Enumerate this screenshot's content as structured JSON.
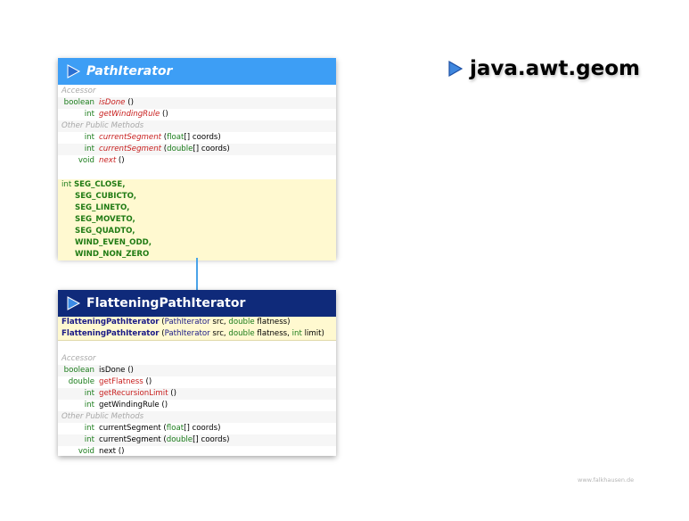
{
  "package": {
    "name": "java.awt.geom"
  },
  "footer": "www.falkhausen.de",
  "path_iterator": {
    "title": "PathIterator",
    "cat_accessor": "Accessor",
    "cat_other": "Other Public Methods",
    "m1_ret": "boolean",
    "m1_name": "isDone",
    "m1_args": " ()",
    "m2_ret": "int",
    "m2_name": "getWindingRule",
    "m2_args": " ()",
    "m3_ret": "int",
    "m3_name": "currentSegment",
    "m3_p1": " (",
    "m3_type": "float",
    "m3_rest": "[] coords)",
    "m4_ret": "int",
    "m4_name": "currentSegment",
    "m4_p1": " (",
    "m4_type": "double",
    "m4_rest": "[] coords)",
    "m5_ret": "void",
    "m5_name": "next",
    "m5_args": " ()",
    "const_type": "int",
    "constants": [
      "SEG_CLOSE,",
      "SEG_CUBICTO,",
      "SEG_LINETO,",
      "SEG_MOVETO,",
      "SEG_QUADTO,",
      "WIND_EVEN_ODD,",
      "WIND_NON_ZERO"
    ]
  },
  "flattening": {
    "title": "FlatteningPathIterator",
    "c1_name": "FlatteningPathIterator",
    "c1_p1": " (",
    "c1_t1": "PathIterator",
    "c1_a1": " src, ",
    "c1_t2": "double",
    "c1_a2": " flatness)",
    "c2_name": "FlatteningPathIterator",
    "c2_p1": " (",
    "c2_t1": "PathIterator",
    "c2_a1": " src, ",
    "c2_t2": "double",
    "c2_a2": " flatness, ",
    "c2_t3": "int",
    "c2_a3": " limit)",
    "cat_accessor": "Accessor",
    "cat_other": "Other Public Methods",
    "a1_ret": "boolean",
    "a1_name": "isDone ()",
    "a2_ret": "double",
    "a2_name": "getFlatness",
    "a2_args": " ()",
    "a3_ret": "int",
    "a3_name": "getRecursionLimit",
    "a3_args": " ()",
    "a4_ret": "int",
    "a4_name": "getWindingRule ()",
    "o1_ret": "int",
    "o1_name": "currentSegment",
    "o1_p1": " (",
    "o1_type": "float",
    "o1_rest": "[] coords)",
    "o2_ret": "int",
    "o2_name": "currentSegment",
    "o2_p1": " (",
    "o2_type": "double",
    "o2_rest": "[] coords)",
    "o3_ret": "void",
    "o3_name": "next ()"
  },
  "colors": {
    "interface_header": "#3d9ef5",
    "class_header": "#0f2a7a",
    "constants_bg": "#fff9d0",
    "connector": "#4aa3e8"
  }
}
